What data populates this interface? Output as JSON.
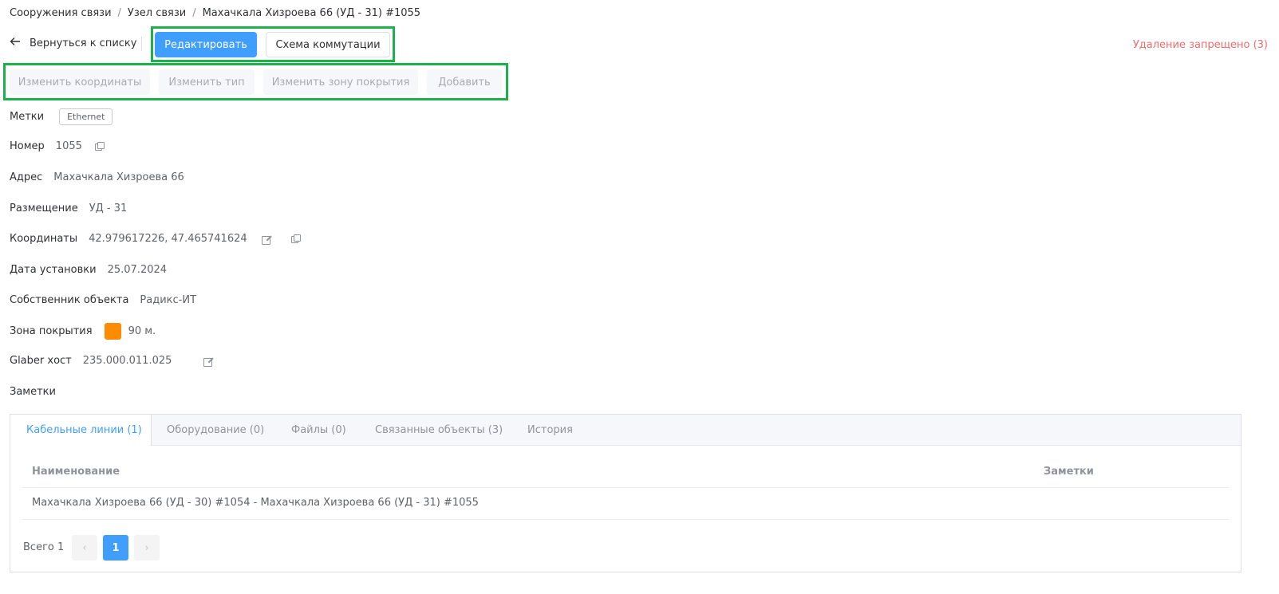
{
  "breadcrumb": {
    "items": [
      "Сооружения связи",
      "Узел связи",
      "Махачкала Хизроева 66 (УД - 31) #1055"
    ],
    "separator": "/"
  },
  "toolbar": {
    "back_label": "Вернуться к списку",
    "edit_label": "Редактировать",
    "scheme_label": "Схема коммутации",
    "deletion_notice": "Удаление запрещено (3)"
  },
  "actions": {
    "change_coords": "Изменить координаты",
    "change_type": "Изменить тип",
    "change_zone": "Изменить зону покрытия",
    "add": "Добавить"
  },
  "fields": {
    "tags_label": "Метки",
    "tags": [
      "Ethernet"
    ],
    "number_label": "Номер",
    "number_value": "1055",
    "address_label": "Адрес",
    "address_value": "Махачкала Хизроева 66",
    "placement_label": "Размещение",
    "placement_value": "УД - 31",
    "coords_label": "Координаты",
    "coords_value": "42.979617226, 47.465741624",
    "install_date_label": "Дата установки",
    "install_date_value": "25.07.2024",
    "owner_label": "Собственник объекта",
    "owner_value": "Радикс-ИТ",
    "coverage_label": "Зона покрытия",
    "coverage_color": "#ff8c00",
    "coverage_value": "90 м.",
    "glaber_label": "Glaber хост",
    "glaber_value": "235.000.011.025",
    "notes_label": "Заметки"
  },
  "tabs": [
    {
      "label": "Кабельные линии (1)",
      "active": true
    },
    {
      "label": "Оборудование (0)",
      "active": false
    },
    {
      "label": "Файлы (0)",
      "active": false
    },
    {
      "label": "Связанные объекты (3)",
      "active": false
    },
    {
      "label": "История",
      "active": false
    }
  ],
  "table": {
    "columns": [
      "Наименование",
      "Заметки"
    ],
    "rows": [
      [
        "Махачкала Хизроева 66 (УД - 30) #1054 - Махачкала Хизроева 66 (УД - 31) #1055",
        ""
      ]
    ]
  },
  "pagination": {
    "total_label": "Всего 1",
    "prev": "‹",
    "current_page": "1",
    "next": "›"
  },
  "colors": {
    "primary": "#409eff",
    "danger": "#f56c6c",
    "highlight": "#1bb24b"
  }
}
